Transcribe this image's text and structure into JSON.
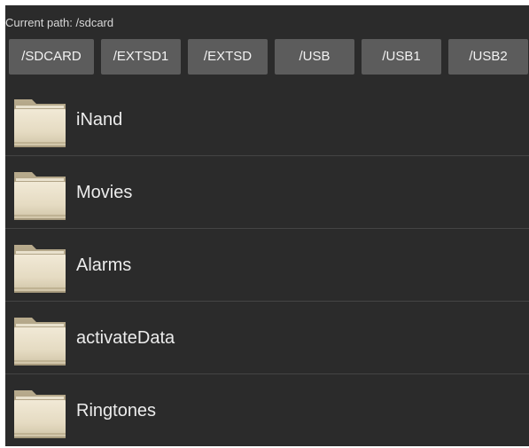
{
  "header": {
    "current_path": "Current path: /sdcard"
  },
  "storage_buttons": [
    {
      "label": "/SDCARD"
    },
    {
      "label": "/EXTSD1"
    },
    {
      "label": "/EXTSD"
    },
    {
      "label": "/USB"
    },
    {
      "label": "/USB1"
    },
    {
      "label": "/USB2"
    }
  ],
  "files": [
    {
      "name": "iNand",
      "icon": "folder-icon"
    },
    {
      "name": "Movies",
      "icon": "folder-icon"
    },
    {
      "name": "Alarms",
      "icon": "folder-icon"
    },
    {
      "name": "activateData",
      "icon": "folder-icon"
    },
    {
      "name": "Ringtones",
      "icon": "folder-icon"
    }
  ],
  "colors": {
    "background": "#2b2b2b",
    "button": "#5c5c5c",
    "text": "#ececec",
    "folder": "#e6dcc4"
  }
}
